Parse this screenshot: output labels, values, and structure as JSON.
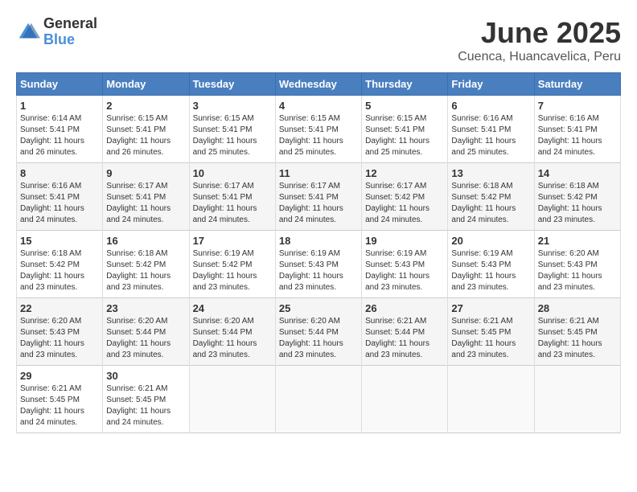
{
  "logo": {
    "general": "General",
    "blue": "Blue"
  },
  "title": "June 2025",
  "location": "Cuenca, Huancavelica, Peru",
  "days_of_week": [
    "Sunday",
    "Monday",
    "Tuesday",
    "Wednesday",
    "Thursday",
    "Friday",
    "Saturday"
  ],
  "weeks": [
    [
      {
        "day": "1",
        "sunrise": "6:14 AM",
        "sunset": "5:41 PM",
        "daylight": "11 hours and 26 minutes."
      },
      {
        "day": "2",
        "sunrise": "6:15 AM",
        "sunset": "5:41 PM",
        "daylight": "11 hours and 26 minutes."
      },
      {
        "day": "3",
        "sunrise": "6:15 AM",
        "sunset": "5:41 PM",
        "daylight": "11 hours and 25 minutes."
      },
      {
        "day": "4",
        "sunrise": "6:15 AM",
        "sunset": "5:41 PM",
        "daylight": "11 hours and 25 minutes."
      },
      {
        "day": "5",
        "sunrise": "6:15 AM",
        "sunset": "5:41 PM",
        "daylight": "11 hours and 25 minutes."
      },
      {
        "day": "6",
        "sunrise": "6:16 AM",
        "sunset": "5:41 PM",
        "daylight": "11 hours and 25 minutes."
      },
      {
        "day": "7",
        "sunrise": "6:16 AM",
        "sunset": "5:41 PM",
        "daylight": "11 hours and 24 minutes."
      }
    ],
    [
      {
        "day": "8",
        "sunrise": "6:16 AM",
        "sunset": "5:41 PM",
        "daylight": "11 hours and 24 minutes."
      },
      {
        "day": "9",
        "sunrise": "6:17 AM",
        "sunset": "5:41 PM",
        "daylight": "11 hours and 24 minutes."
      },
      {
        "day": "10",
        "sunrise": "6:17 AM",
        "sunset": "5:41 PM",
        "daylight": "11 hours and 24 minutes."
      },
      {
        "day": "11",
        "sunrise": "6:17 AM",
        "sunset": "5:41 PM",
        "daylight": "11 hours and 24 minutes."
      },
      {
        "day": "12",
        "sunrise": "6:17 AM",
        "sunset": "5:42 PM",
        "daylight": "11 hours and 24 minutes."
      },
      {
        "day": "13",
        "sunrise": "6:18 AM",
        "sunset": "5:42 PM",
        "daylight": "11 hours and 24 minutes."
      },
      {
        "day": "14",
        "sunrise": "6:18 AM",
        "sunset": "5:42 PM",
        "daylight": "11 hours and 23 minutes."
      }
    ],
    [
      {
        "day": "15",
        "sunrise": "6:18 AM",
        "sunset": "5:42 PM",
        "daylight": "11 hours and 23 minutes."
      },
      {
        "day": "16",
        "sunrise": "6:18 AM",
        "sunset": "5:42 PM",
        "daylight": "11 hours and 23 minutes."
      },
      {
        "day": "17",
        "sunrise": "6:19 AM",
        "sunset": "5:42 PM",
        "daylight": "11 hours and 23 minutes."
      },
      {
        "day": "18",
        "sunrise": "6:19 AM",
        "sunset": "5:43 PM",
        "daylight": "11 hours and 23 minutes."
      },
      {
        "day": "19",
        "sunrise": "6:19 AM",
        "sunset": "5:43 PM",
        "daylight": "11 hours and 23 minutes."
      },
      {
        "day": "20",
        "sunrise": "6:19 AM",
        "sunset": "5:43 PM",
        "daylight": "11 hours and 23 minutes."
      },
      {
        "day": "21",
        "sunrise": "6:20 AM",
        "sunset": "5:43 PM",
        "daylight": "11 hours and 23 minutes."
      }
    ],
    [
      {
        "day": "22",
        "sunrise": "6:20 AM",
        "sunset": "5:43 PM",
        "daylight": "11 hours and 23 minutes."
      },
      {
        "day": "23",
        "sunrise": "6:20 AM",
        "sunset": "5:44 PM",
        "daylight": "11 hours and 23 minutes."
      },
      {
        "day": "24",
        "sunrise": "6:20 AM",
        "sunset": "5:44 PM",
        "daylight": "11 hours and 23 minutes."
      },
      {
        "day": "25",
        "sunrise": "6:20 AM",
        "sunset": "5:44 PM",
        "daylight": "11 hours and 23 minutes."
      },
      {
        "day": "26",
        "sunrise": "6:21 AM",
        "sunset": "5:44 PM",
        "daylight": "11 hours and 23 minutes."
      },
      {
        "day": "27",
        "sunrise": "6:21 AM",
        "sunset": "5:45 PM",
        "daylight": "11 hours and 23 minutes."
      },
      {
        "day": "28",
        "sunrise": "6:21 AM",
        "sunset": "5:45 PM",
        "daylight": "11 hours and 23 minutes."
      }
    ],
    [
      {
        "day": "29",
        "sunrise": "6:21 AM",
        "sunset": "5:45 PM",
        "daylight": "11 hours and 24 minutes."
      },
      {
        "day": "30",
        "sunrise": "6:21 AM",
        "sunset": "5:45 PM",
        "daylight": "11 hours and 24 minutes."
      },
      null,
      null,
      null,
      null,
      null
    ]
  ]
}
